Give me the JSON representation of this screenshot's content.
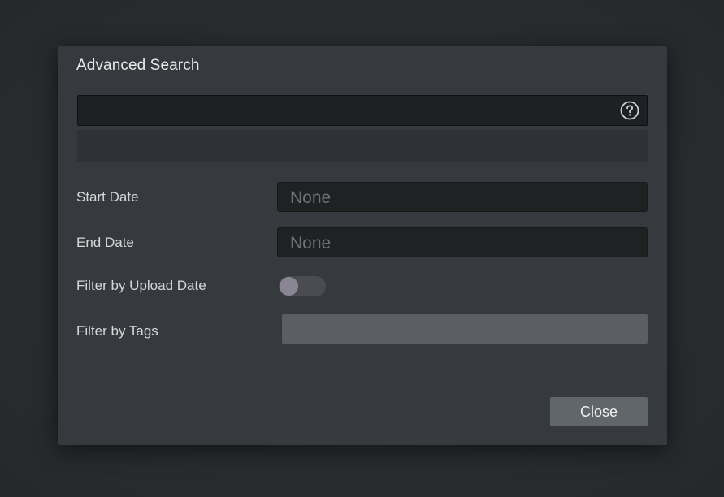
{
  "dialog": {
    "title": "Advanced Search"
  },
  "search": {
    "value": "",
    "placeholder": "",
    "help_icon": "question-circle-icon"
  },
  "filters": {
    "start_date": {
      "label": "Start Date",
      "value": "None"
    },
    "end_date": {
      "label": "End Date",
      "value": "None"
    },
    "upload_date": {
      "label": "Filter by Upload Date",
      "enabled": false
    },
    "tags": {
      "label": "Filter by Tags",
      "value": ""
    }
  },
  "actions": {
    "close_label": "Close"
  },
  "colors": {
    "backdrop": "#2b2d30",
    "dialog_bg": "#36393e",
    "input_bg": "#1e2024",
    "button_bg": "#61666b",
    "toggle_knob": "#8a8592"
  }
}
